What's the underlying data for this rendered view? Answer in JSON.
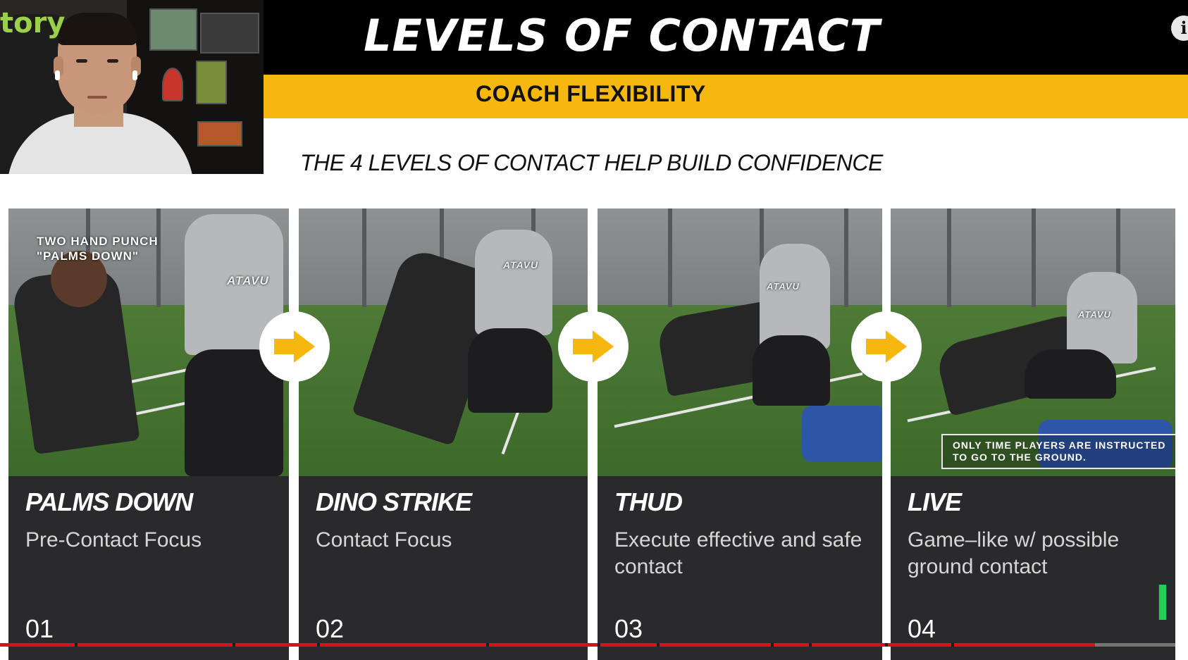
{
  "slide": {
    "title": "LEVELS OF CONTACT",
    "subtitle": "COACH FLEXIBILITY",
    "tagline": "THE 4 LEVELS OF CONTACT HELP BUILD CONFIDENCE"
  },
  "webcam": {
    "chair_logo": "tory"
  },
  "cards": [
    {
      "title": "PALMS DOWN",
      "desc": "Pre-Contact Focus",
      "num": "01",
      "overlay": "TWO HAND PUNCH\n\"PALMS DOWN\""
    },
    {
      "title": "DINO STRIKE",
      "desc": "Contact Focus",
      "num": "02"
    },
    {
      "title": "THUD",
      "desc": "Execute effective and safe contact",
      "num": "03"
    },
    {
      "title": "LIVE",
      "desc": "Game–like w/ possible ground contact",
      "num": "04",
      "note": "ONLY TIME PLAYERS ARE INSTRUCTED\nTO GO TO THE GROUND."
    }
  ],
  "shirt_text": [
    "ATAVU",
    "ATAVU",
    "ATAVU",
    "ATAVU"
  ],
  "player": {
    "info_icon_label": "i",
    "progress": 0.922
  },
  "colors": {
    "accent_yellow": "#f6b70e",
    "card_dark": "#2a2a2c",
    "progress_red": "#e01010"
  },
  "icons": [
    "arrow-right-icon",
    "info-icon"
  ]
}
